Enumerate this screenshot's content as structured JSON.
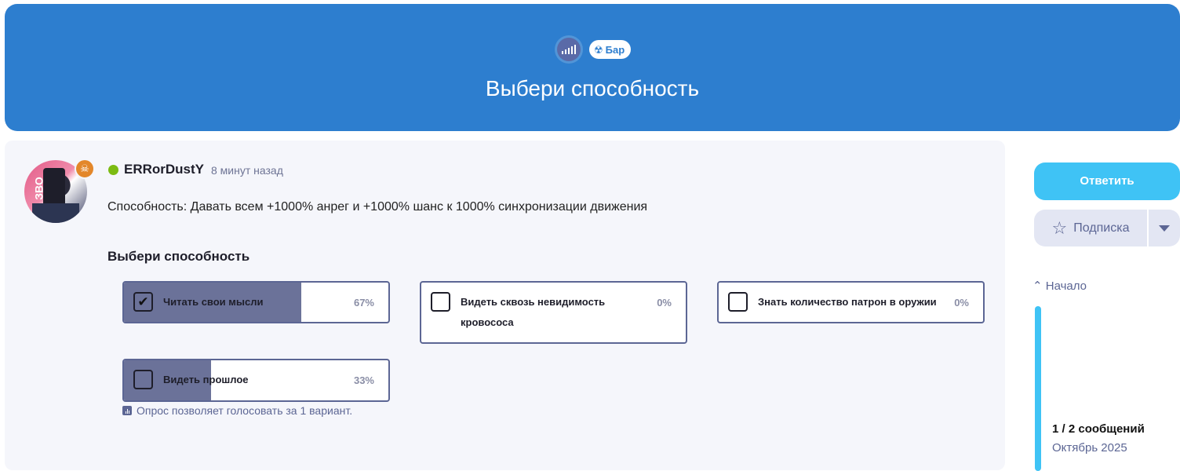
{
  "header": {
    "tag_label": "Бар",
    "title": "Выбери способность"
  },
  "post": {
    "username": "ERRorDustY",
    "time": "8 минут назад",
    "text": "Способность: Давать всем +1000% анрег и +1000% шанс к 1000% синхронизации движения",
    "avatar_text": "ЗВО"
  },
  "poll": {
    "title": "Выбери способность",
    "options": [
      {
        "label": "Читать свои мысли",
        "percent": "67%",
        "checked": true,
        "fill": 0.67
      },
      {
        "label": "Видеть сквозь невидимость кровососа",
        "percent": "0%",
        "checked": false,
        "fill": 0
      },
      {
        "label": "Знать количество патрон в оружии",
        "percent": "0%",
        "checked": false,
        "fill": 0
      },
      {
        "label": "Видеть прошлое",
        "percent": "33%",
        "checked": false,
        "fill": 0.33
      }
    ],
    "note": "Опрос позволяет голосовать за 1 вариант."
  },
  "sidebar": {
    "reply_label": "Ответить",
    "subscribe_label": "Подписка",
    "top_label": "Начало",
    "message_count": "1 / 2 сообщений",
    "date": "Октябрь 2025"
  },
  "colors": {
    "banner": "#2d7ecf",
    "accent": "#3fc3f5",
    "poll_fill": "#6b7299",
    "online": "#7cbb12",
    "badge": "#e3872a"
  }
}
